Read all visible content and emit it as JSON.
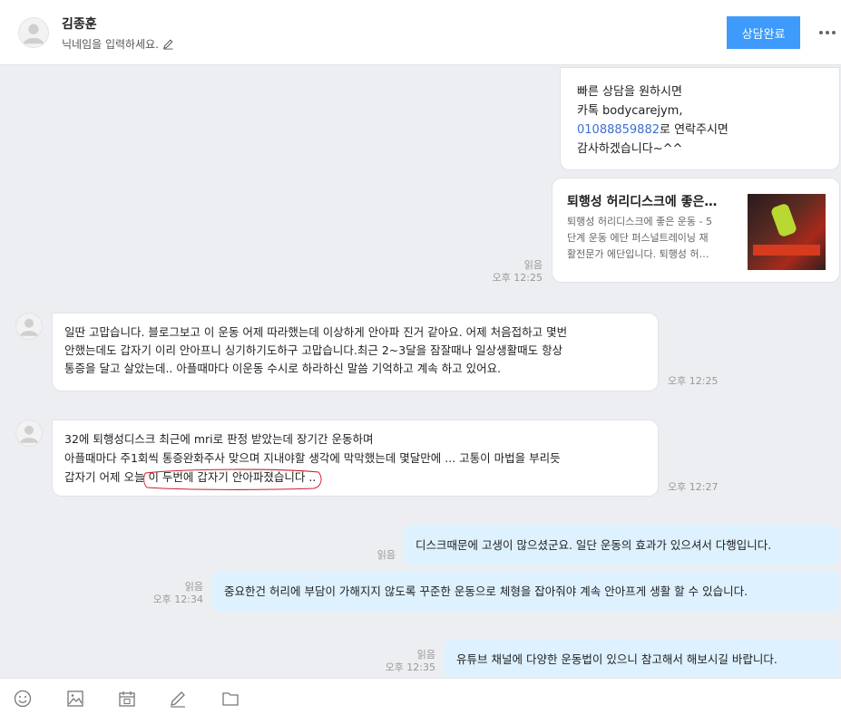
{
  "header": {
    "contact_name": "김종훈",
    "nickname_placeholder": "닉네임을 입력하세요.",
    "done_button": "상담완료",
    "icons": {
      "avatar": "person-avatar",
      "edit": "pencil-icon",
      "more": "more-icon"
    }
  },
  "messages": {
    "m1": {
      "line1": "빠른 상담을 원하시면",
      "line2": "카톡 bodycarejym,",
      "phone": "01088859882",
      "line3_suffix": "로 연락주시면",
      "line4": "감사하겠습니다~^^"
    },
    "card": {
      "title": "퇴행성 허리디스크에 좋은…",
      "desc1": "퇴행성 허리디스크에 좋은 운동 - 5",
      "desc2": "단계 운동 에단 퍼스널트레이닝 재",
      "desc3": "활전문가 에단입니다. 퇴행성 허…",
      "read": "읽음",
      "time": "오후 12:25"
    },
    "m3": {
      "line1": "일딴 고맙습니다. 블로그보고 이 운동 어제 따라했는데 이상하게 안아파 진거 같아요. 어제 처음접하고 몇번",
      "line2": "안했는데도 갑자기 이리 안아프니 싱기하기도하구 고맙습니다.최근 2~3달을 잠잘때나 일상생활때도 항상",
      "line3": "통증을 달고 살았는데.. 아플때마다 이운동 수시로 하라하신 말씀 기억하고 계속 하고 있어요.",
      "time": "오후 12:25"
    },
    "m4": {
      "line1": "32에 퇴행성디스크 최근에 mri로 판정 받았는데 장기간 운동하며",
      "line2": "아플때마다 주1회씩 통증완화주사 맞으며 지내야할 생각에 막막했는데 몇달만에 ... 고통이 마법을 부리듯",
      "line3_prefix": "갑자기 어제 오늘",
      "line3_marked": "이 두번에 갑자기 안아파졌습니다 ..",
      "time": "오후 12:27"
    },
    "m5": {
      "text": "디스크때문에 고생이 많으셨군요. 일단 운동의 효과가 있으셔서 다행입니다.",
      "read": "읽음"
    },
    "m6": {
      "text": "중요한건 허리에 부담이 가해지지 않도록 꾸준한 운동으로 체형을 잡아줘야 계속 안아프게 생활 할 수 있습니다.",
      "read": "읽음",
      "time": "오후 12:34"
    },
    "m7": {
      "text": "유튜브 채널에 다양한 운동법이 있으니 참고해서 해보시길 바랍니다.",
      "read": "읽음",
      "time": "오후 12:35"
    }
  },
  "composer": {
    "icons": [
      "emoji-icon",
      "image-icon",
      "calendar-icon",
      "pen-icon",
      "folder-icon"
    ]
  },
  "colors": {
    "accent": "#3e9bfb",
    "sent_bubble": "#def1ff",
    "received_bubble": "#ffffff",
    "background": "#edeef1",
    "link": "#3b6fd6",
    "annotation": "#cc1f2a"
  }
}
